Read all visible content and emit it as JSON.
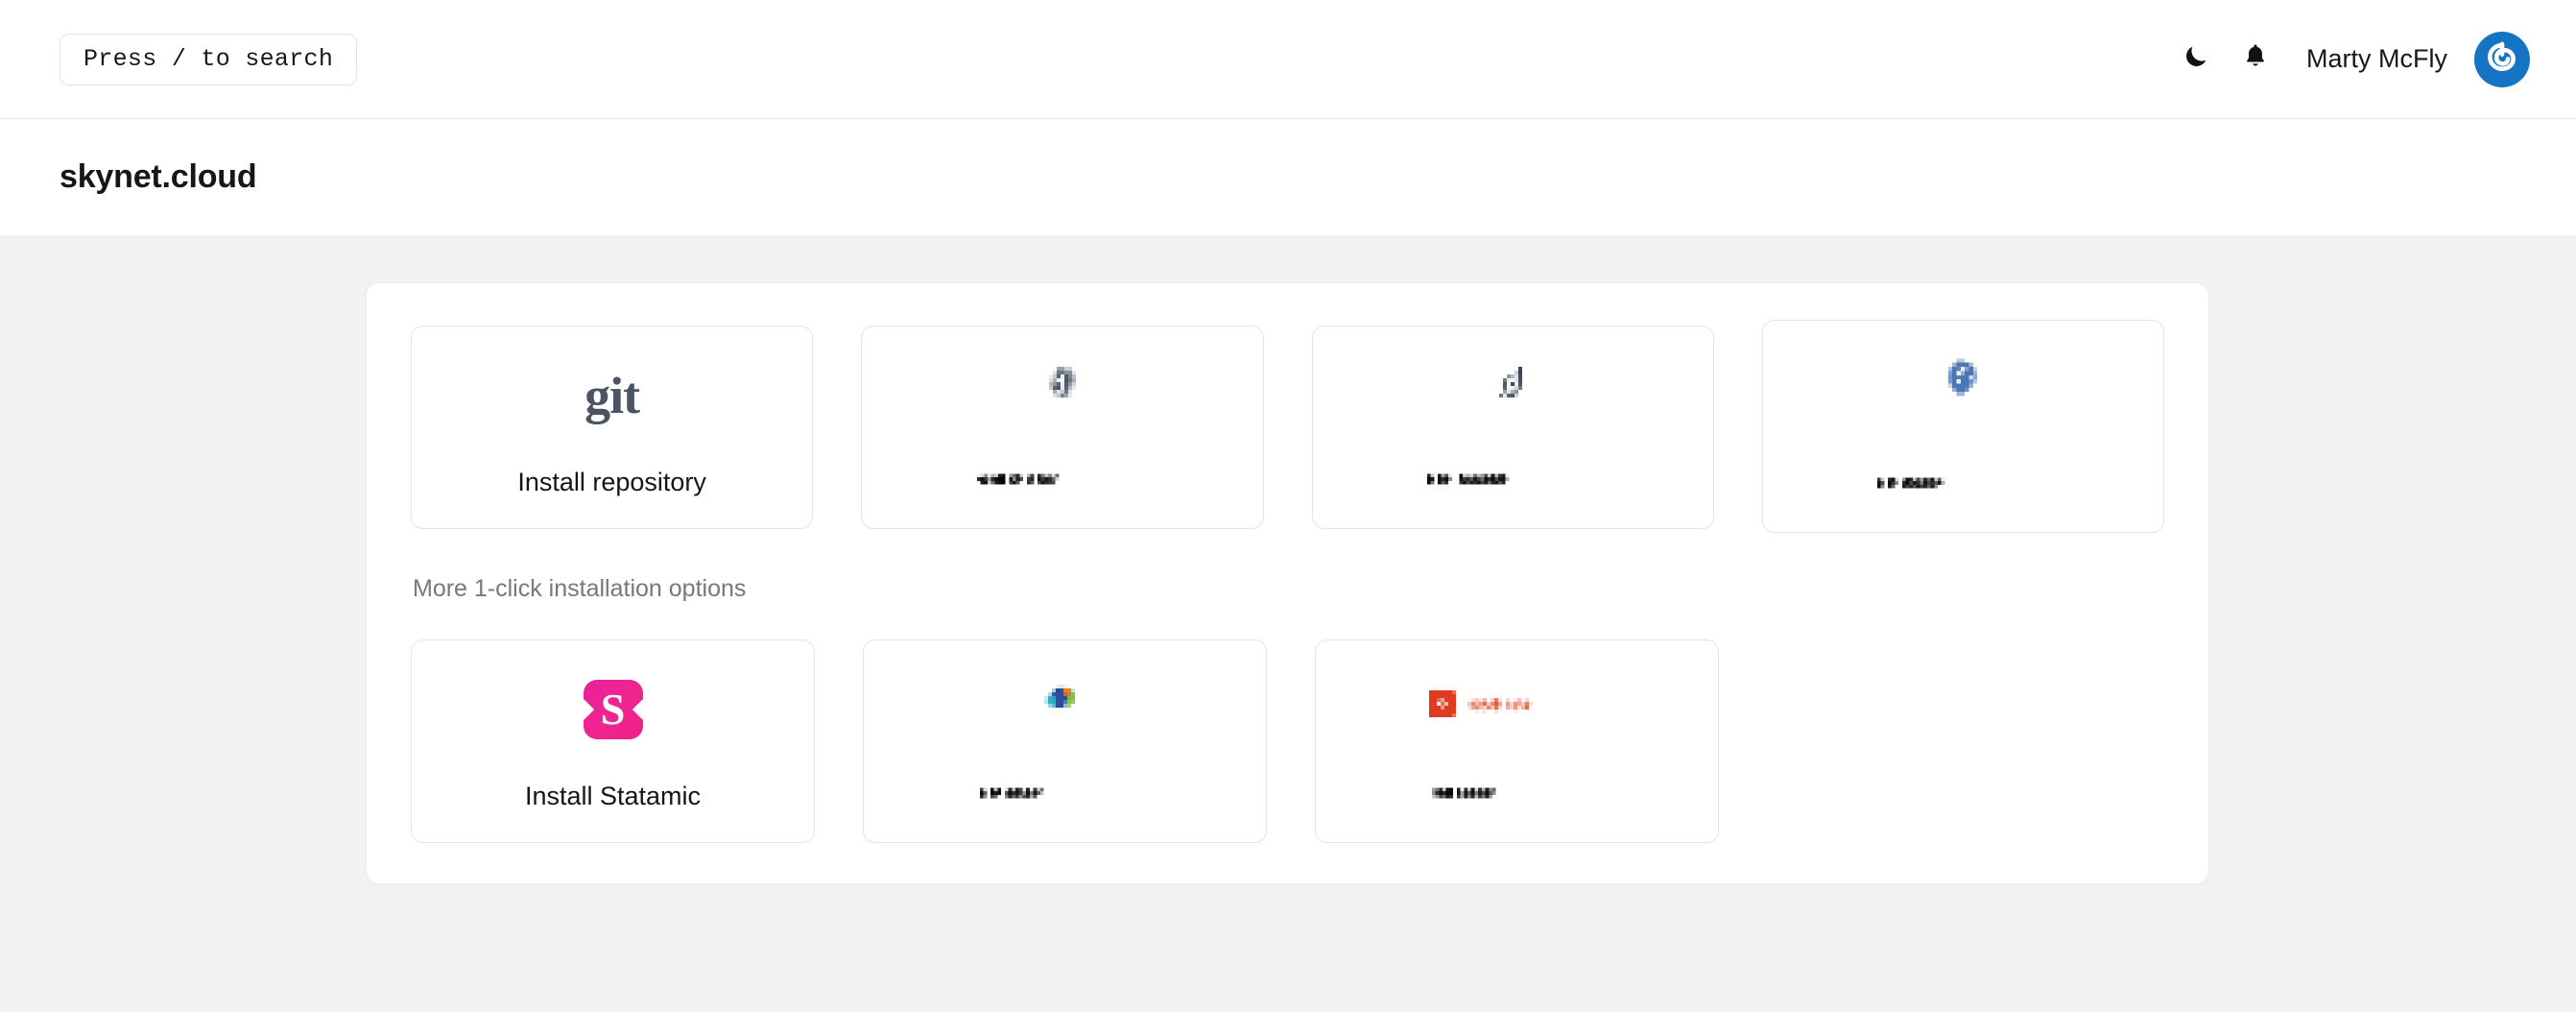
{
  "topbar": {
    "search_placeholder": "Press / to search",
    "dark_mode_icon": "moon-icon",
    "notifications_icon": "bell-icon",
    "user_name": "Marty McFly",
    "avatar_icon": "power-swirl-icon",
    "avatar_color": "#1574c4"
  },
  "header": {
    "title": "skynet.cloud"
  },
  "main": {
    "section_label": "More 1-click installation options",
    "primary_cards": [
      {
        "id": "git",
        "logo_type": "git-wordmark",
        "logo_text": "git",
        "logo_color": "#4a5464",
        "label": "Install repository",
        "censored": false
      },
      {
        "id": "card-2",
        "logo_type": "pixelated-logo",
        "logo_color": "#55606f",
        "label": "",
        "censored": true
      },
      {
        "id": "card-3",
        "logo_type": "pixelated-logo",
        "logo_color": "#4d5767",
        "label": "",
        "censored": true
      },
      {
        "id": "card-4",
        "logo_type": "pixelated-logo",
        "logo_color": "#4a79b8",
        "label": "",
        "censored": true
      }
    ],
    "secondary_cards": [
      {
        "id": "statamic",
        "logo_type": "statamic-mark",
        "logo_text": "S",
        "logo_color": "#ef1f8c",
        "label": "Install Statamic",
        "censored": false
      },
      {
        "id": "card-6",
        "logo_type": "pixelated-logo",
        "logo_color": "#2b4b9b",
        "label": "",
        "censored": true
      },
      {
        "id": "card-7",
        "logo_type": "pixelated-logo",
        "logo_color": "#e03a22",
        "label": "",
        "censored": true
      }
    ]
  },
  "colors": {
    "page_background": "#f1f2f4",
    "panel_background": "#ffffff",
    "card_border": "#e4e5e7",
    "text_primary": "#15161a",
    "text_muted": "#75787e"
  }
}
